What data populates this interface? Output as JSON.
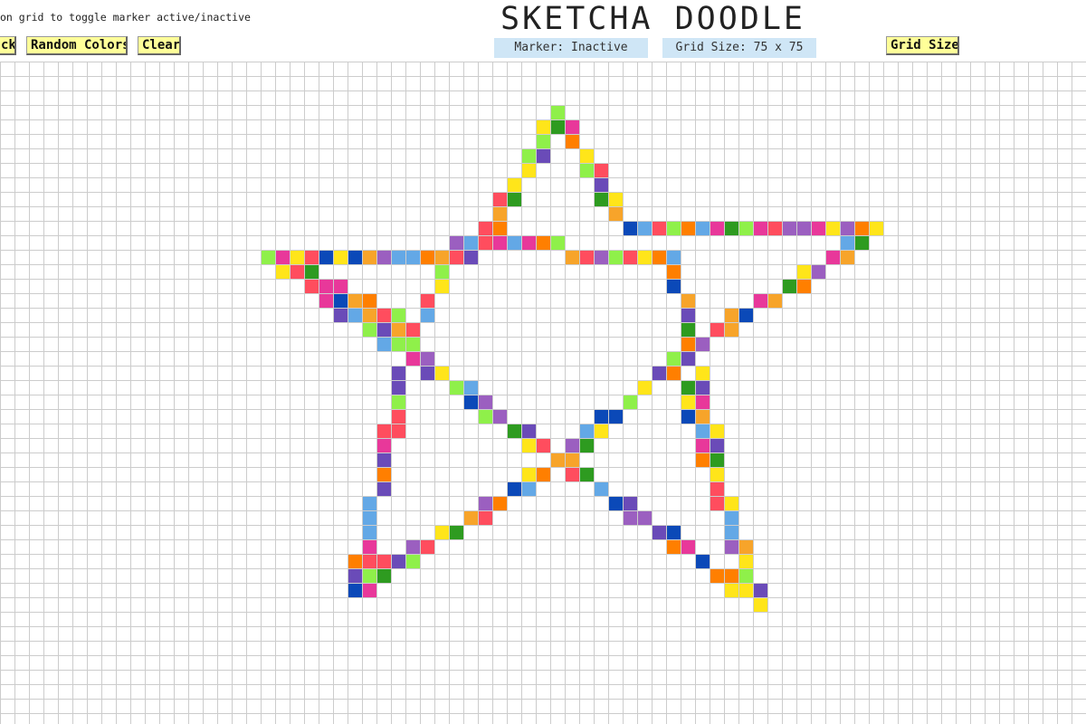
{
  "hint": "on grid to toggle marker active/inactive",
  "title": "SKETCHA DOODLE",
  "buttons": {
    "back": "ck",
    "random_colors": "Random Colors",
    "clear": "Clear",
    "grid_size": "Grid Size"
  },
  "status": {
    "marker": "Marker: Inactive",
    "grid_size": "Grid Size: 75 x 75"
  },
  "grid": {
    "columns": 75,
    "rows": 75,
    "line_color": "#cccccc"
  },
  "palette": [
    "#ff4d5e",
    "#e8389a",
    "#ff7f00",
    "#f7a42a",
    "#ffe51a",
    "#8ff04a",
    "#2e9b20",
    "#63a8e6",
    "#0b49b8",
    "#6a4bb8",
    "#9b5fc0"
  ],
  "marker_active": false
}
